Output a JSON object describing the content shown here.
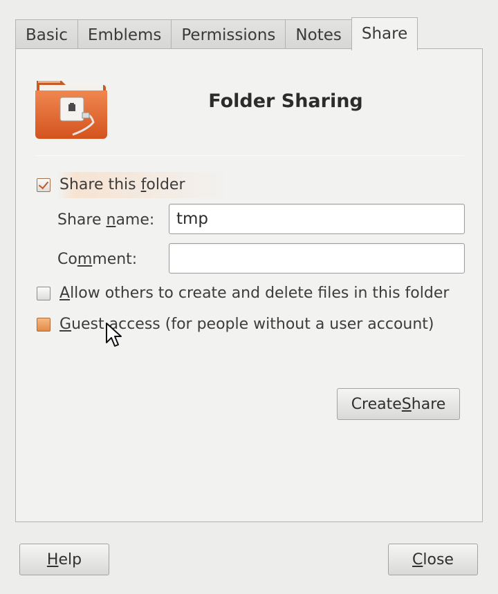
{
  "tabs": [
    {
      "label": "Basic"
    },
    {
      "label": "Emblems"
    },
    {
      "label": "Permissions"
    },
    {
      "label": "Notes"
    },
    {
      "label": "Share"
    }
  ],
  "active_tab": "Share",
  "header": {
    "title": "Folder Sharing",
    "icon": "folder-share-icon"
  },
  "share_folder": {
    "pre": "Share this ",
    "mnemonic": "f",
    "post": "older",
    "checked": true
  },
  "share_name": {
    "pre": "Share ",
    "mnemonic": "n",
    "post": "ame:",
    "value": "tmp"
  },
  "comment": {
    "pre": "Co",
    "mnemonic": "m",
    "post": "ment:",
    "value": ""
  },
  "allow_others": {
    "pre": "",
    "mnemonic": "A",
    "post": "llow others to create and delete files in this folder",
    "checked": false
  },
  "guest_access": {
    "pre": "",
    "mnemonic": "G",
    "post": "uest access (for people without a user account)",
    "checked": false
  },
  "create_share": {
    "pre": "Create ",
    "mnemonic": "S",
    "post": "hare"
  },
  "help": {
    "pre": "",
    "mnemonic": "H",
    "post": "elp"
  },
  "close": {
    "pre": "",
    "mnemonic": "C",
    "post": "lose"
  },
  "colors": {
    "accent": "#e0622f",
    "window_bg": "#ededec"
  }
}
